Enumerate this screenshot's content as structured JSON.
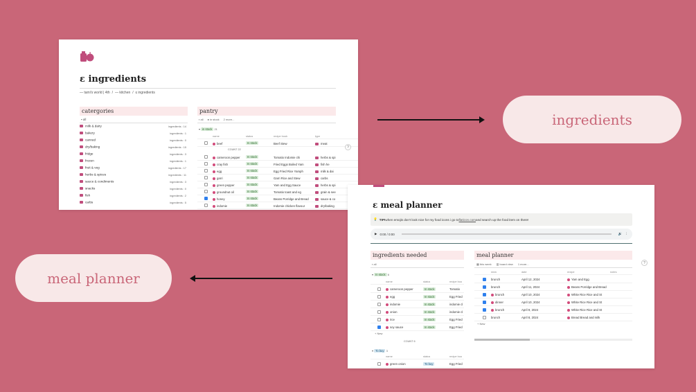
{
  "labels": {
    "ingredients": "ingredients",
    "meal_planner": "meal planner"
  },
  "ingredients_page": {
    "title": "ingredients",
    "title_icon": "ɛ",
    "breadcrumb": [
      "— tami's world | 4th",
      "— kitchen",
      "ɛ ingredients"
    ],
    "categories": {
      "header": "catergories",
      "tab": "all",
      "items": [
        {
          "label": "milk & dairy",
          "count": "ingredients : 14"
        },
        {
          "label": "bakery",
          "count": "ingredients : 1"
        },
        {
          "label": "canned",
          "count": "ingredients : 0"
        },
        {
          "label": "dry/baking",
          "count": "ingredients : 15"
        },
        {
          "label": "fridge",
          "count": "ingredients : 3"
        },
        {
          "label": "frozen",
          "count": "ingredients : 1"
        },
        {
          "label": "fruit & veg",
          "count": "ingredients : 17"
        },
        {
          "label": "herbs & spices",
          "count": "ingredients : 11"
        },
        {
          "label": "sauce & condiments",
          "count": "ingredients : 3"
        },
        {
          "label": "snacks",
          "count": "ingredients : 0"
        },
        {
          "label": "fish",
          "count": "ingredients : 2"
        },
        {
          "label": "carbs",
          "count": "ingredients : 5"
        }
      ]
    },
    "pantry": {
      "header": "pantry",
      "tabs": [
        "all",
        "in stock",
        "2 more..."
      ],
      "group": "in stock",
      "group_count": "21",
      "columns": [
        "name",
        "status",
        "recipe book",
        "type"
      ],
      "first_row": {
        "name": "beef",
        "status": "In stock",
        "recipe": "Beef Stew",
        "type": "meat"
      },
      "count_label": "COUNT 22",
      "rows": [
        {
          "name": "cameroon pepper",
          "status": "In stock",
          "recipe": "Tomatio  Indomie chi",
          "type": "herbs & spi",
          "checked": false
        },
        {
          "name": "cray fish",
          "status": "In stock",
          "recipe": "Fried Eggs  Boiled Yam",
          "type": "fish  he",
          "checked": false
        },
        {
          "name": "egg",
          "status": "In stock",
          "recipe": "Egg Fried Rice  Yamph",
          "type": "milk & dai",
          "checked": false
        },
        {
          "name": "garri",
          "status": "In stock",
          "recipe": "Garri  Rice and Stew",
          "type": "carbs",
          "checked": false
        },
        {
          "name": "green pepper",
          "status": "In stock",
          "recipe": "Yam and Egg  Sauce",
          "type": "herbs & spi",
          "checked": false
        },
        {
          "name": "groundnut oil",
          "status": "In stock",
          "recipe": "Tomatio  toast and eg",
          "type": "grain & see",
          "checked": false
        },
        {
          "name": "honey",
          "status": "In stock",
          "recipe": "Beans Porridge and Bread",
          "type": "sauce & co",
          "checked": true
        },
        {
          "name": "indomie",
          "status": "In stock",
          "recipe": "Indomie chicken flavour",
          "type": "dry/baking",
          "checked": false
        }
      ]
    }
  },
  "meal_page": {
    "title": "meal planner",
    "title_icon": "ɛ",
    "tip_bold": "TIP!",
    "tip_text": " when emojis don't look nice for my food icons i go to ",
    "tip_link": "flaticon.com",
    "tip_rest": " and search up the food item on there!",
    "audio_time": "0:00 / 0:00",
    "needed": {
      "header": "ingredients needed",
      "tab": "all",
      "group": "In stock",
      "group_count": "6",
      "columns": [
        "name",
        "status",
        "recipe boo"
      ],
      "rows": [
        {
          "name": "cameroon pepper",
          "status": "In stock",
          "recipe": "Tomatio",
          "checked": false
        },
        {
          "name": "egg",
          "status": "In stock",
          "recipe": "Egg Fried",
          "checked": false
        },
        {
          "name": "indomie",
          "status": "In stock",
          "recipe": "indomie cl",
          "checked": false
        },
        {
          "name": "onion",
          "status": "In stock",
          "recipe": "indomie cl",
          "checked": false
        },
        {
          "name": "rice",
          "status": "In stock",
          "recipe": "Egg Fried",
          "checked": false
        },
        {
          "name": "soy sauce",
          "status": "In stock",
          "recipe": "Egg Fried",
          "checked": true
        }
      ],
      "new": "+ New",
      "count_label": "COUNT 6",
      "group2": "To buy",
      "group2_count": "3",
      "row2": {
        "name": "green onion",
        "status": "To buy",
        "recipe": "Egg Fried"
      }
    },
    "planner": {
      "header": "meal planner",
      "tabs": [
        "this week",
        "board view",
        "1 more..."
      ],
      "columns": [
        "meal",
        "date",
        "recipe",
        "notes"
      ],
      "rows": [
        {
          "meal": "brunch",
          "date": "April 12, 2024",
          "recipe": "Yam and Egg",
          "checked": true,
          "icon": false
        },
        {
          "meal": "brunch",
          "date": "April 11, 2024",
          "recipe": "Beans Porridge and Bread",
          "checked": true,
          "icon": false
        },
        {
          "meal": "brunch",
          "date": "April 10, 2024",
          "recipe": "White Rice  Rice and St",
          "checked": true,
          "icon": true
        },
        {
          "meal": "dinner",
          "date": "April 10, 2024",
          "recipe": "White Rice  Rice and St",
          "checked": true,
          "icon": true
        },
        {
          "meal": "brunch",
          "date": "April 9, 2024",
          "recipe": "White Rice  Rice and St",
          "checked": true,
          "icon": true
        },
        {
          "meal": "brunch",
          "date": "April 8, 2024",
          "recipe": "Bread  Bread and milk",
          "checked": false,
          "icon": false
        }
      ],
      "new": "+ New"
    }
  },
  "help": "?"
}
